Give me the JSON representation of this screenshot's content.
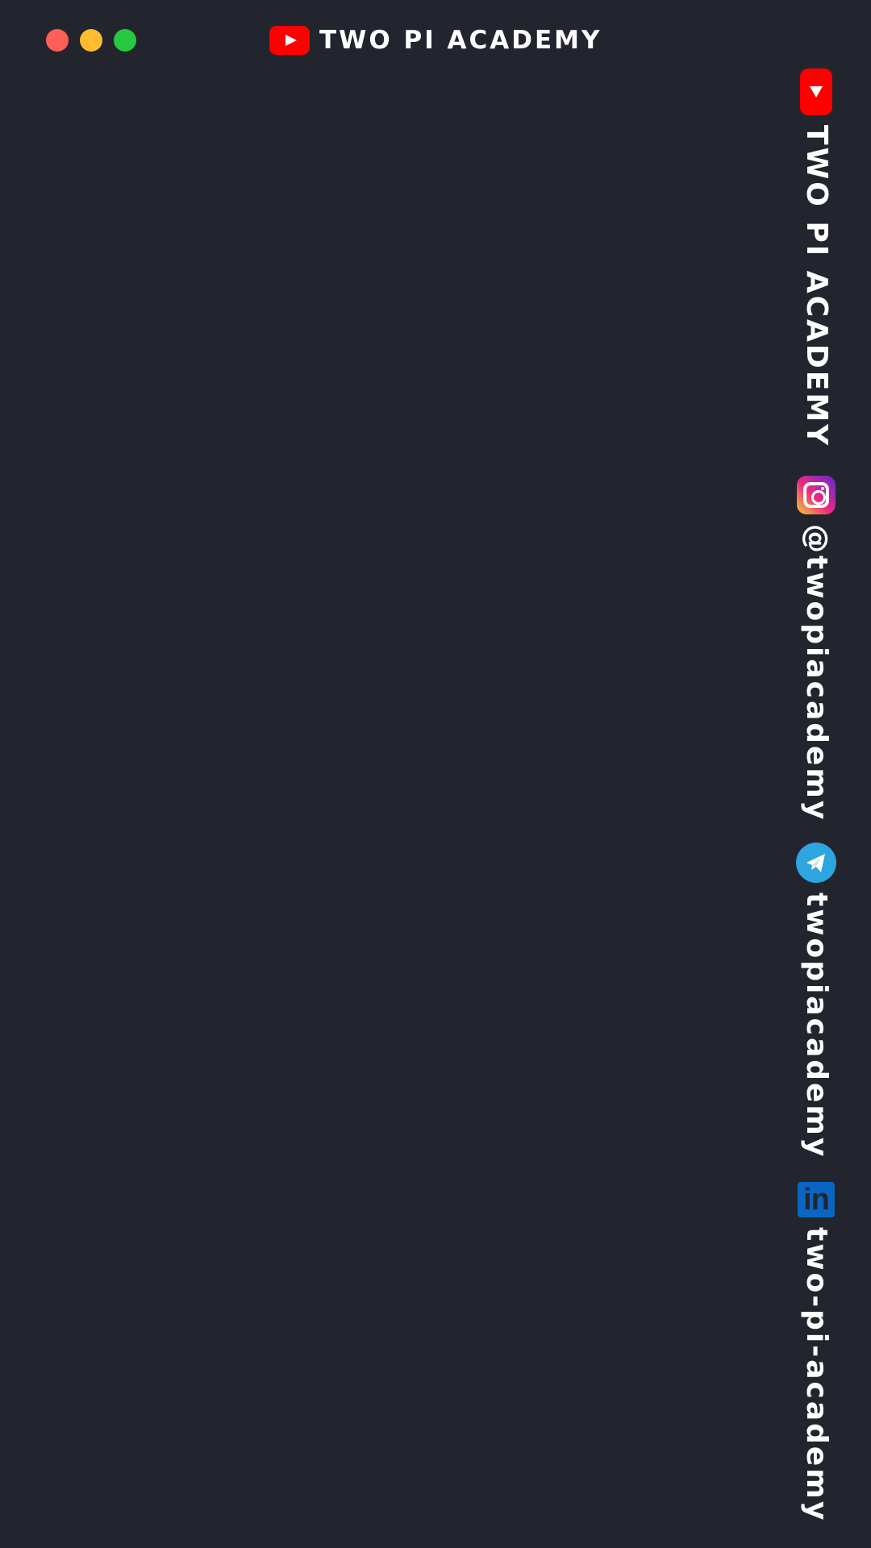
{
  "window": {
    "title": "TWO PI ACADEMY"
  },
  "socials": [
    {
      "icon": "youtube-icon",
      "label": "TWO PI ACADEMY",
      "color": "#ff0000"
    },
    {
      "icon": "instagram-icon",
      "label": "@twopiacademy",
      "color": "#e1306c"
    },
    {
      "icon": "telegram-icon",
      "label": "twopiacademy",
      "color": "#2ca5e0"
    },
    {
      "icon": "linkedin-icon",
      "label": "two-pi-academy",
      "color": "#0a66c2",
      "glyph": "in"
    }
  ],
  "colors": {
    "background": "#22252e",
    "close": "#fe5f57",
    "minimize": "#febc2e",
    "maximize": "#28c840"
  }
}
